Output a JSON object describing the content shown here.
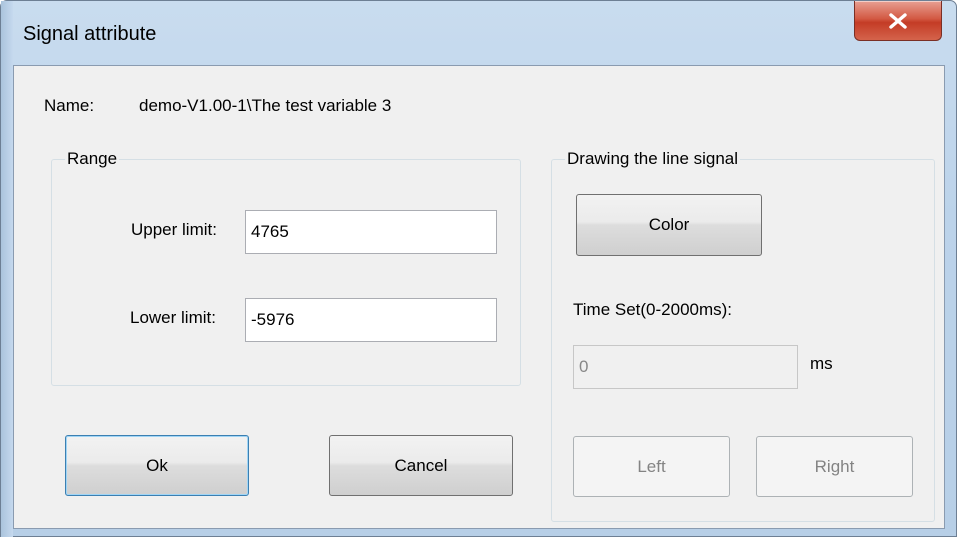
{
  "window": {
    "title": "Signal attribute",
    "close_icon": "close-x-icon"
  },
  "name": {
    "label": "Name:",
    "value": "demo-V1.00-1\\The test variable 3"
  },
  "range": {
    "caption": "Range",
    "upper_label": "Upper limit:",
    "upper_value": "4765",
    "lower_label": "Lower limit:",
    "lower_value": "-5976"
  },
  "drawing": {
    "caption": "Drawing the line signal",
    "color_button": "Color",
    "time_label": "Time Set(0-2000ms):",
    "time_value": "0",
    "time_unit": "ms",
    "left_button": "Left",
    "right_button": "Right"
  },
  "actions": {
    "ok": "Ok",
    "cancel": "Cancel"
  },
  "colors": {
    "close_button": "#c43c26",
    "default_button_border": "#3c7fb1",
    "dialog_background": "#f0f0f0"
  }
}
